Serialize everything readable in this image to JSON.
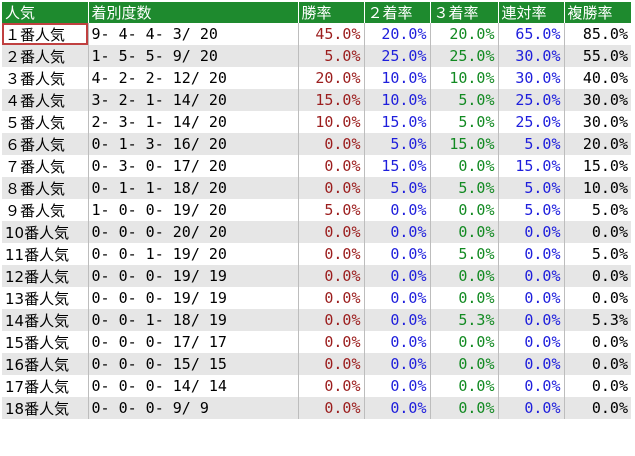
{
  "colors": {
    "header_bg": "#1e8a2e",
    "win": "#9b1d1d",
    "second": "#1e1edc",
    "third": "#128a22",
    "quinella": "#1e1edc",
    "place": "#000000"
  },
  "headers": {
    "popularity": "人気",
    "record": "着別度数",
    "win_rate": "勝率",
    "second_rate": "２着率",
    "third_rate": "３着率",
    "quinella_rate": "連対率",
    "place_rate": "複勝率"
  },
  "rows": [
    {
      "label": "１番人気",
      "record": " 9-  4-  4-  3/ 20",
      "win": "45.0%",
      "second": "20.0%",
      "third": "20.0%",
      "quinella": "65.0%",
      "place": "85.0%"
    },
    {
      "label": "２番人気",
      "record": " 1-  5-  5-  9/ 20",
      "win": "5.0%",
      "second": "25.0%",
      "third": "25.0%",
      "quinella": "30.0%",
      "place": "55.0%"
    },
    {
      "label": "３番人気",
      "record": " 4-  2-  2- 12/ 20",
      "win": "20.0%",
      "second": "10.0%",
      "third": "10.0%",
      "quinella": "30.0%",
      "place": "40.0%"
    },
    {
      "label": "４番人気",
      "record": " 3-  2-  1- 14/ 20",
      "win": "15.0%",
      "second": "10.0%",
      "third": "5.0%",
      "quinella": "25.0%",
      "place": "30.0%"
    },
    {
      "label": "５番人気",
      "record": " 2-  3-  1- 14/ 20",
      "win": "10.0%",
      "second": "15.0%",
      "third": "5.0%",
      "quinella": "25.0%",
      "place": "30.0%"
    },
    {
      "label": "６番人気",
      "record": " 0-  1-  3- 16/ 20",
      "win": "0.0%",
      "second": "5.0%",
      "third": "15.0%",
      "quinella": "5.0%",
      "place": "20.0%"
    },
    {
      "label": "７番人気",
      "record": " 0-  3-  0- 17/ 20",
      "win": "0.0%",
      "second": "15.0%",
      "third": "0.0%",
      "quinella": "15.0%",
      "place": "15.0%"
    },
    {
      "label": "８番人気",
      "record": " 0-  1-  1- 18/ 20",
      "win": "0.0%",
      "second": "5.0%",
      "third": "5.0%",
      "quinella": "5.0%",
      "place": "10.0%"
    },
    {
      "label": "９番人気",
      "record": " 1-  0-  0- 19/ 20",
      "win": "5.0%",
      "second": "0.0%",
      "third": "0.0%",
      "quinella": "5.0%",
      "place": "5.0%"
    },
    {
      "label": "10番人気",
      "record": " 0-  0-  0- 20/ 20",
      "win": "0.0%",
      "second": "0.0%",
      "third": "0.0%",
      "quinella": "0.0%",
      "place": "0.0%"
    },
    {
      "label": "11番人気",
      "record": " 0-  0-  1- 19/ 20",
      "win": "0.0%",
      "second": "0.0%",
      "third": "5.0%",
      "quinella": "0.0%",
      "place": "5.0%"
    },
    {
      "label": "12番人気",
      "record": " 0-  0-  0- 19/ 19",
      "win": "0.0%",
      "second": "0.0%",
      "third": "0.0%",
      "quinella": "0.0%",
      "place": "0.0%"
    },
    {
      "label": "13番人気",
      "record": " 0-  0-  0- 19/ 19",
      "win": "0.0%",
      "second": "0.0%",
      "third": "0.0%",
      "quinella": "0.0%",
      "place": "0.0%"
    },
    {
      "label": "14番人気",
      "record": " 0-  0-  1- 18/ 19",
      "win": "0.0%",
      "second": "0.0%",
      "third": "5.3%",
      "quinella": "0.0%",
      "place": "5.3%"
    },
    {
      "label": "15番人気",
      "record": " 0-  0-  0- 17/ 17",
      "win": "0.0%",
      "second": "0.0%",
      "third": "0.0%",
      "quinella": "0.0%",
      "place": "0.0%"
    },
    {
      "label": "16番人気",
      "record": " 0-  0-  0- 15/ 15",
      "win": "0.0%",
      "second": "0.0%",
      "third": "0.0%",
      "quinella": "0.0%",
      "place": "0.0%"
    },
    {
      "label": "17番人気",
      "record": " 0-  0-  0- 14/ 14",
      "win": "0.0%",
      "second": "0.0%",
      "third": "0.0%",
      "quinella": "0.0%",
      "place": "0.0%"
    },
    {
      "label": "18番人気",
      "record": " 0-  0-  0-  9/  9",
      "win": "0.0%",
      "second": "0.0%",
      "third": "0.0%",
      "quinella": "0.0%",
      "place": "0.0%"
    }
  ]
}
